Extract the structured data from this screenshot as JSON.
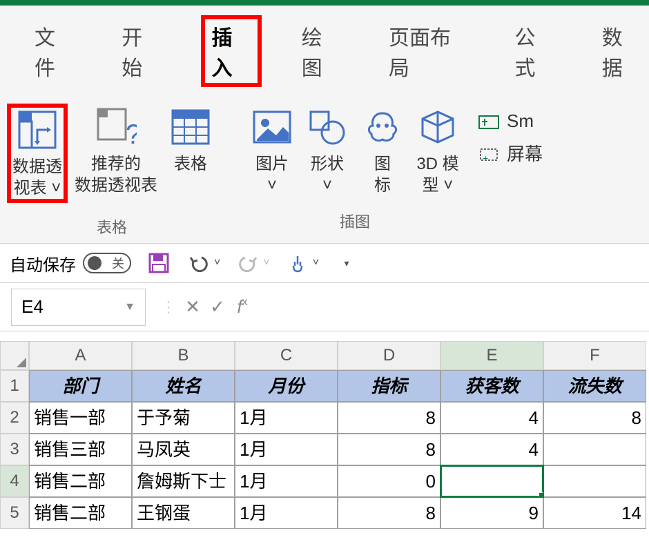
{
  "tabs": [
    "文件",
    "开始",
    "插入",
    "绘图",
    "页面布局",
    "公式",
    "数据"
  ],
  "active_tab": "插入",
  "ribbon": {
    "group_tables_label": "表格",
    "group_illustrations_label": "插图",
    "pivot_table": "数据透\n视表 ˅",
    "recommended_pivot": "推荐的\n数据透视表",
    "table_btn": "表格",
    "pictures_btn": "图片\n˅",
    "shapes_btn": "形状\n˅",
    "icons_btn": "图\n标",
    "models_btn": "3D 模\n型 ˅",
    "smartart_btn": "Sm",
    "screenshot_btn": "屏幕"
  },
  "qat": {
    "autosave_label": "自动保存",
    "autosave_state": "关"
  },
  "name_box": "E4",
  "columns": [
    "A",
    "B",
    "C",
    "D",
    "E",
    "F"
  ],
  "headers": [
    "部门",
    "姓名",
    "月份",
    "指标",
    "获客数",
    "流失数"
  ],
  "rows": [
    {
      "n": "2",
      "c": [
        "销售一部",
        "于予菊",
        "1月",
        "8",
        "4",
        "8"
      ]
    },
    {
      "n": "3",
      "c": [
        "销售三部",
        "马凤英",
        "1月",
        "8",
        "4",
        ""
      ]
    },
    {
      "n": "4",
      "c": [
        "销售二部",
        "詹姆斯下士",
        "1月",
        "0",
        "",
        ""
      ]
    },
    {
      "n": "5",
      "c": [
        "销售二部",
        "王钢蛋",
        "1月",
        "8",
        "9",
        "14"
      ]
    }
  ],
  "selected_cell": "E4"
}
